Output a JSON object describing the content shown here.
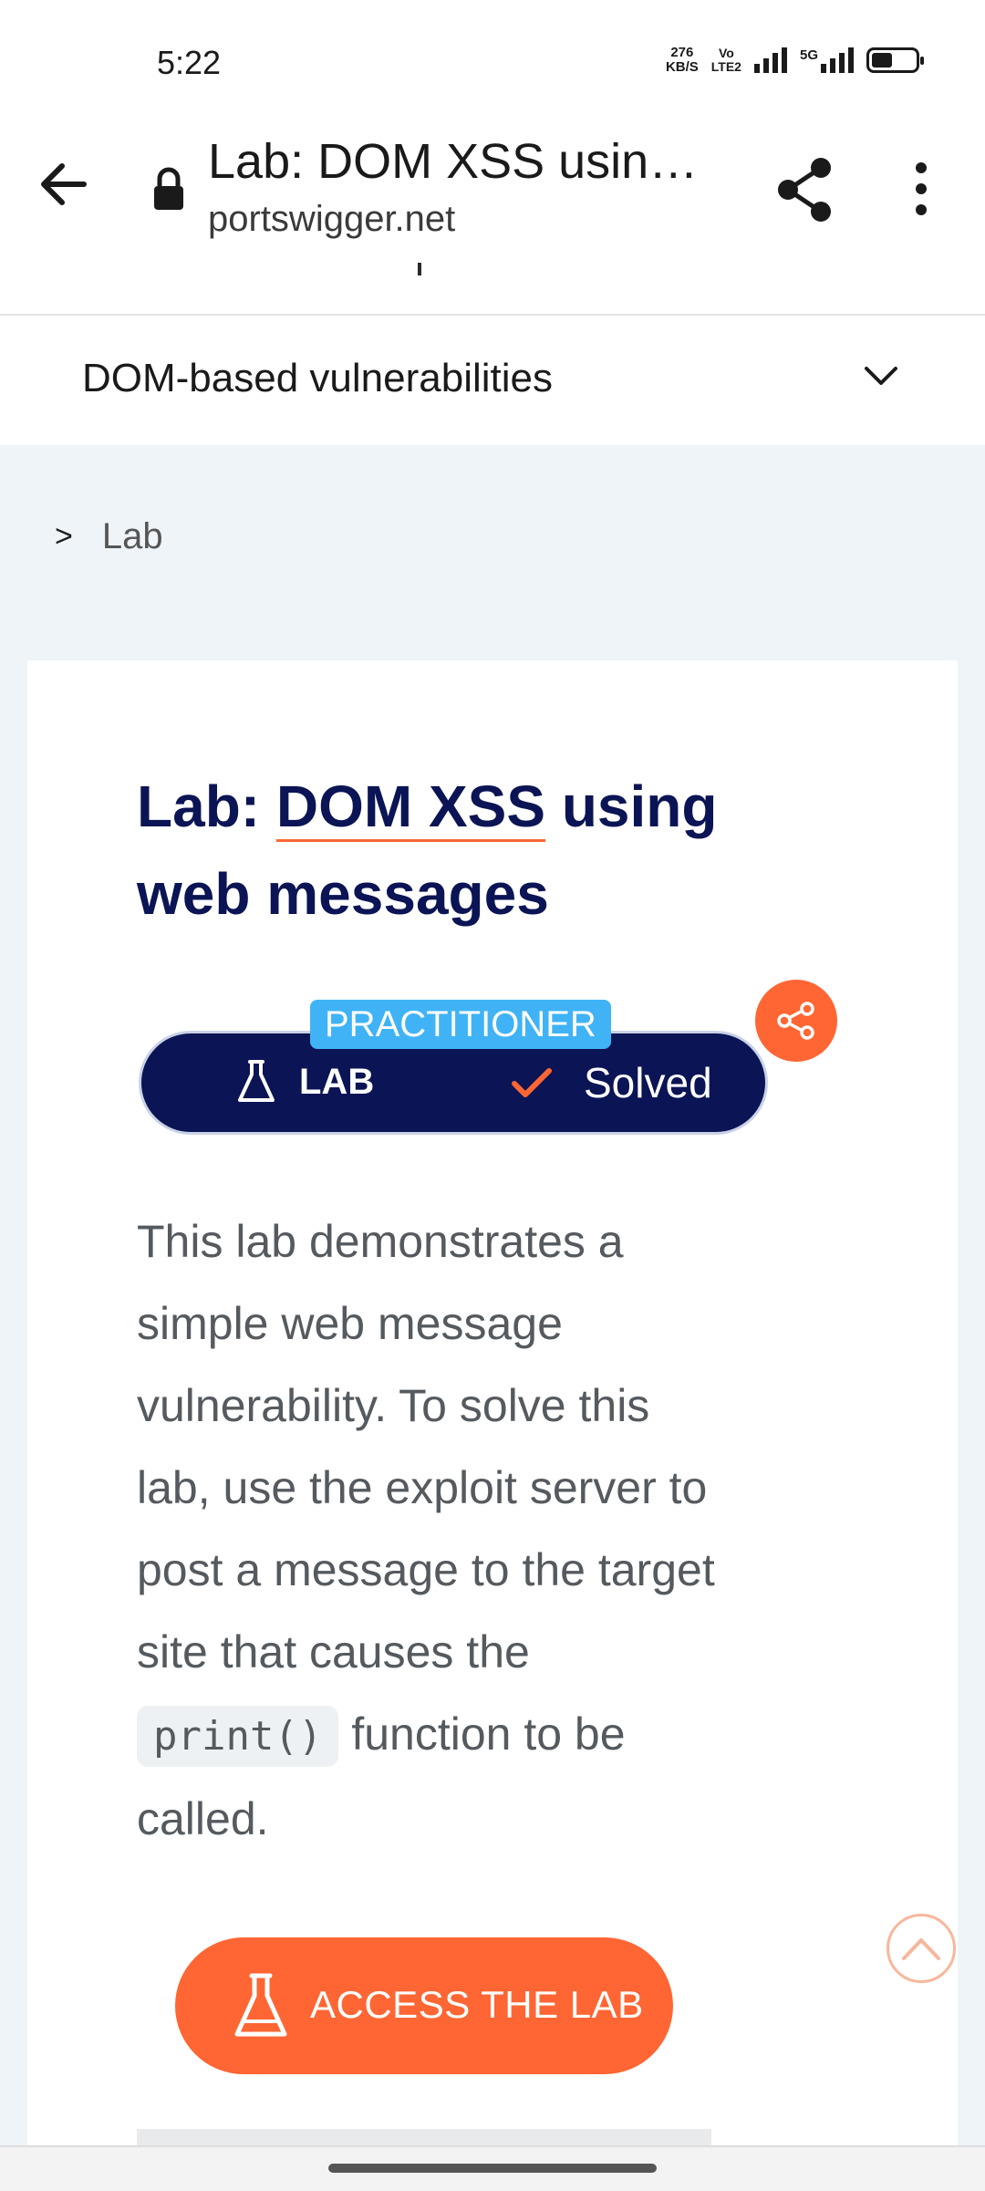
{
  "status_bar": {
    "time": "5:22",
    "speed_top": "276",
    "speed_unit": "KB/S",
    "volte_top": "Vo",
    "volte_bottom": "LTE2",
    "network": "5G"
  },
  "browser": {
    "page_title": "Lab: DOM XSS usin…",
    "host": "portswigger.net"
  },
  "nav": {
    "section_label": "DOM-based vulnerabilities"
  },
  "breadcrumb": {
    "separator": ">",
    "current": "Lab"
  },
  "lab": {
    "title_prefix": "Lab: ",
    "title_link": "DOM XSS",
    "title_suffix": " using web messages",
    "level": "PRACTITIONER",
    "type_label": "LAB",
    "status_label": "Solved",
    "description_before": "This lab demonstrates a simple web message vulnerability. To solve this lab, use the exploit server to post a message to the target site that causes the ",
    "code": "print()",
    "description_after": " function to be called.",
    "access_button": "ACCESS THE LAB"
  },
  "colors": {
    "navy": "#0b1454",
    "accent_orange": "#ff6633",
    "badge_blue": "#3fb3f5",
    "page_bg": "#eef4f7"
  }
}
